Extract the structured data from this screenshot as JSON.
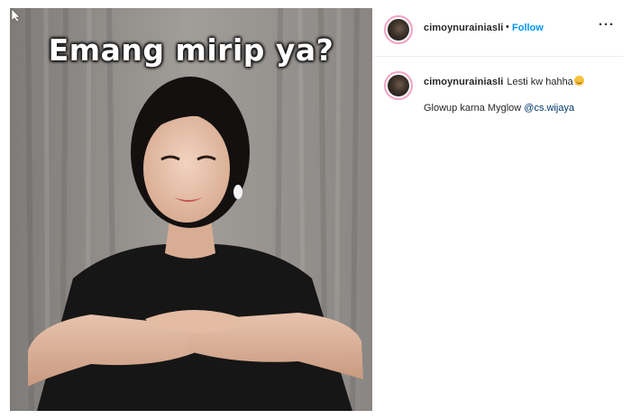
{
  "media": {
    "overlay_caption": "Emang mirip ya?"
  },
  "header": {
    "username": "cimoynurainiasli",
    "separator": "•",
    "follow_label": "Follow",
    "more_label": "···"
  },
  "comment": {
    "username": "cimoynurainiasli",
    "text": "Lesti kw hahha",
    "emoji": "rolling-on-floor-laughing-emoji",
    "line2_text": "Glowup karna Myglow ",
    "mention": "@cs.wijaya"
  },
  "colors": {
    "follow": "#0095f6",
    "mention": "#00376b",
    "avatar_ring": "#f3a2c5",
    "text": "#262626"
  }
}
